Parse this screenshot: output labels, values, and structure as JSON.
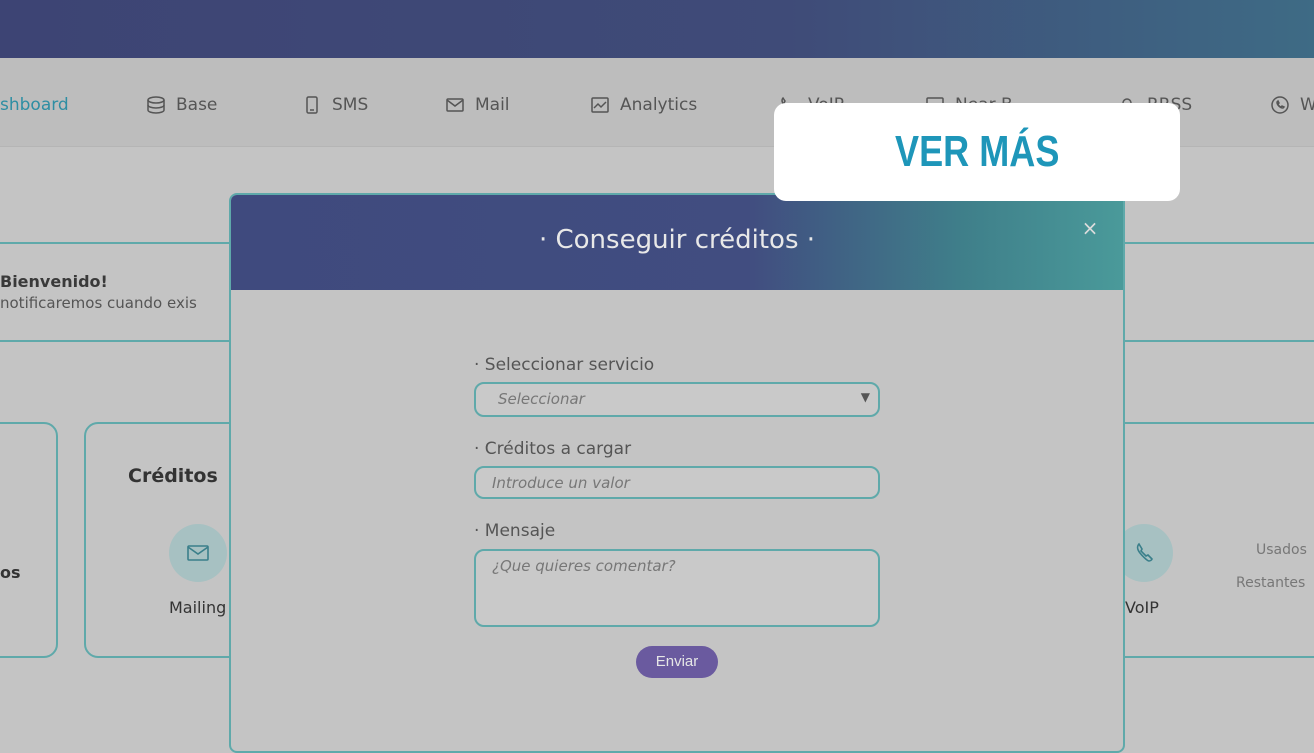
{
  "nav": {
    "items": [
      {
        "label": "shboard",
        "icon": "dashboard-icon"
      },
      {
        "label": "Base",
        "icon": "database-icon"
      },
      {
        "label": "SMS",
        "icon": "phone-icon"
      },
      {
        "label": "Mail",
        "icon": "mail-icon"
      },
      {
        "label": "Analytics",
        "icon": "analytics-icon"
      },
      {
        "label": "VoIP",
        "icon": "voip-icon"
      },
      {
        "label": "Near B",
        "icon": "monitor-icon"
      },
      {
        "label": "RRSS",
        "icon": "social-icon"
      },
      {
        "label": "W",
        "icon": "whatsapp-icon"
      }
    ]
  },
  "welcome": {
    "title": "Bienvenido!",
    "subtitle": "notificaremos cuando exis"
  },
  "cards": {
    "credits_title": "Créditos",
    "left_label": "os",
    "mailing_label": "Mailing",
    "voip_label": "VoIP",
    "used_label": "Usados",
    "remaining_label": "Restantes"
  },
  "promo": {
    "label": "VER MÁS",
    "color": "#1e96b9"
  },
  "modal": {
    "title": "· Conseguir créditos ·",
    "close_label": "×",
    "service_label": "· Seleccionar servicio",
    "service_value": "Seleccionar",
    "credits_label": "· Créditos a cargar",
    "credits_placeholder": "Introduce un valor",
    "message_label": "· Mensaje",
    "message_placeholder": "¿Que quieres comentar?",
    "send_label": "Enviar"
  }
}
